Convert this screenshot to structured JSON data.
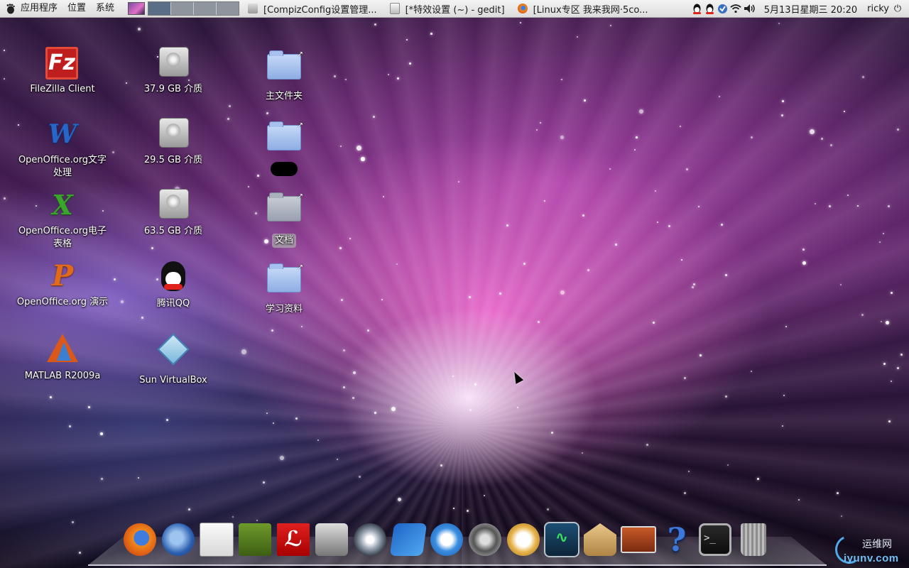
{
  "top_panel": {
    "menus": [
      "应用程序",
      "位置",
      "系统"
    ],
    "taskbar": [
      {
        "title": "[CompizConfig设置管理...",
        "icon": "settings-window-icon"
      },
      {
        "title": "[*特效设置 (~) - gedit]",
        "icon": "gedit-icon"
      },
      {
        "title": "[Linux专区 我来我网·5co...",
        "icon": "firefox-icon"
      }
    ],
    "clock": "5月13日星期三 20:20",
    "user": "ricky",
    "tray_icons": [
      "qq-icon",
      "qq-icon",
      "network-manager-icon",
      "wifi-icon",
      "volume-icon"
    ]
  },
  "desktop": {
    "icons": [
      {
        "label": "FileZilla Client",
        "icon": "filezilla-icon"
      },
      {
        "label": "OpenOffice.org文字处理",
        "icon": "openoffice-writer-icon"
      },
      {
        "label": "OpenOffice.org电子表格",
        "icon": "openoffice-calc-icon"
      },
      {
        "label": "OpenOffice.org 演示",
        "icon": "openoffice-impress-icon"
      },
      {
        "label": "MATLAB R2009a",
        "icon": "matlab-icon"
      },
      {
        "label": "37.9 GB 介质",
        "icon": "hard-drive-icon"
      },
      {
        "label": "29.5 GB 介质",
        "icon": "hard-drive-icon"
      },
      {
        "label": "63.5 GB 介质",
        "icon": "hard-drive-icon"
      },
      {
        "label": "腾讯QQ",
        "icon": "qq-penguin-icon"
      },
      {
        "label": "Sun VirtualBox",
        "icon": "virtualbox-icon"
      },
      {
        "label": "主文件夹",
        "icon": "home-folder-icon"
      },
      {
        "label": "",
        "icon": "folder-icon"
      },
      {
        "label": "文档",
        "icon": "folder-icon"
      },
      {
        "label": "学习资料",
        "icon": "folder-icon"
      }
    ]
  },
  "dock": {
    "items": [
      "firefox-icon",
      "thunderbird-icon",
      "text-editor-icon",
      "books-icon",
      "pdf-reader-icon",
      "camera-icon",
      "audio-wave-icon",
      "video-clapper-icon",
      "browser-icon",
      "film-reel-icon",
      "disc-burner-icon",
      "system-monitor-icon",
      "package-installer-icon",
      "laptop-presentation-icon",
      "help-icon",
      "terminal-icon",
      "trash-icon"
    ]
  },
  "watermark": {
    "cn": "运维网",
    "en": "iyunv.com"
  },
  "colors": {
    "panel_bg": "#dcdcdc",
    "wallpaper_pink": "#e060c8",
    "wallpaper_purple": "#4a1e58",
    "label_text": "#ffffff"
  }
}
